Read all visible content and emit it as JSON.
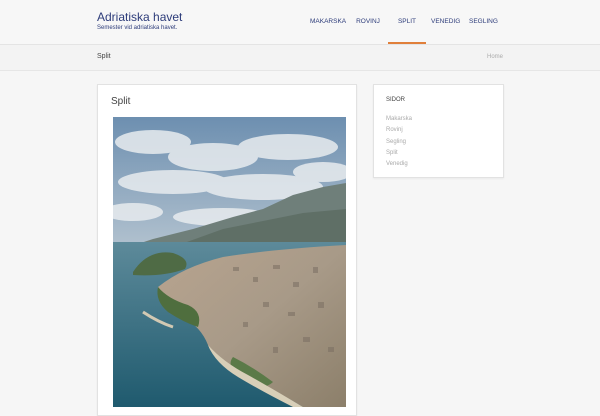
{
  "site": {
    "title": "Adriatiska havet",
    "description": "Semester vid adriatiska havet."
  },
  "nav": {
    "items": [
      {
        "label": "MAKARSKA"
      },
      {
        "label": "ROVINJ"
      },
      {
        "label": "SPLIT"
      },
      {
        "label": "VENEDIG"
      },
      {
        "label": "SEGLING"
      }
    ],
    "active": "SPLIT",
    "accent_color": "#e07f3a",
    "link_color": "#2d3c7a"
  },
  "breadcrumb": {
    "title": "Split",
    "home": "Home"
  },
  "post": {
    "title": "Split",
    "image": "aerial-photo-of-split-coastline"
  },
  "sidebar": {
    "widget_title": "SIDOR",
    "items": [
      {
        "label": "Makarska"
      },
      {
        "label": "Rovinj"
      },
      {
        "label": "Segling"
      },
      {
        "label": "Split"
      },
      {
        "label": "Venedig"
      }
    ]
  }
}
